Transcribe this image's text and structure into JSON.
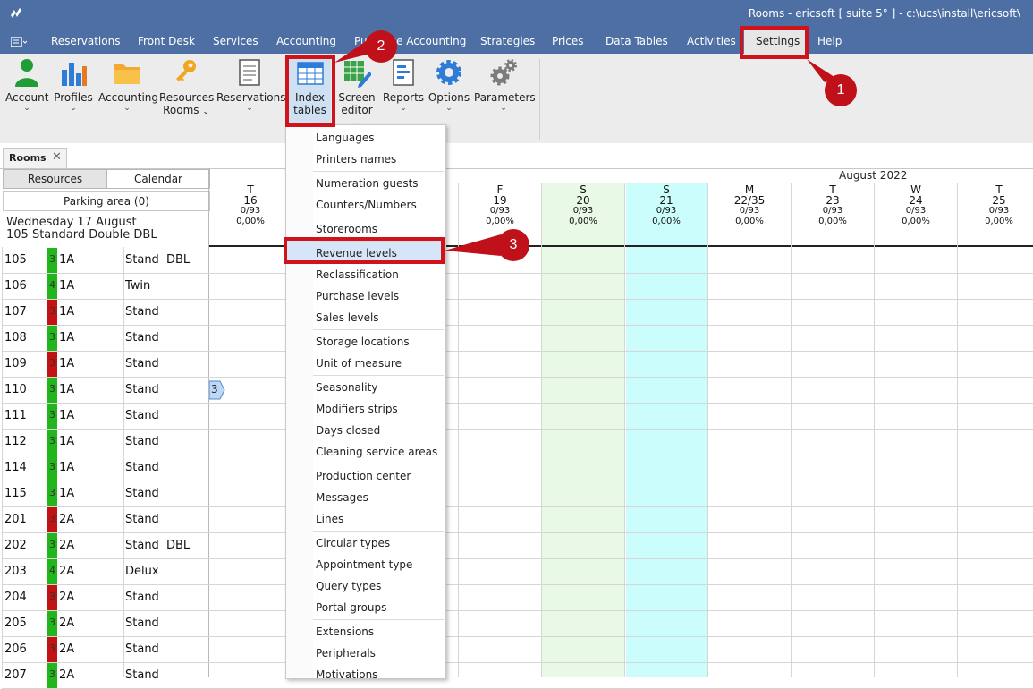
{
  "window": {
    "title": "Rooms - ericsoft [ suite 5° ] - c:\\ucs\\install\\ericsoft\\"
  },
  "menu": [
    "Reservations",
    "Front Desk",
    "Services",
    "Accounting",
    "Purchase Accounting",
    "Strategies",
    "Prices",
    "Data Tables",
    "Activities",
    "Settings",
    "Help"
  ],
  "ribbon": {
    "account": "Account",
    "profiles": "Profiles",
    "accounting": "Accounting",
    "resources_rooms": [
      "Resources",
      "Rooms"
    ],
    "reservations": "Reservations",
    "index_tables": [
      "Index",
      "tables"
    ],
    "screen_editor": [
      "Screen",
      "editor"
    ],
    "reports": "Reports",
    "options": "Options",
    "parameters": "Parameters"
  },
  "badges": [
    "1",
    "2",
    "3"
  ],
  "tabs": {
    "rooms": "Rooms",
    "close": "✕"
  },
  "left_panel": {
    "resources_tab": "Resources",
    "calendar_tab": "Calendar",
    "parking": "Parking area (0)",
    "date_line": "Wednesday 17 August",
    "room_line": "105 Standard Double DBL"
  },
  "calendar": {
    "month": "August 2022",
    "days": [
      {
        "dow": "T",
        "day": "16",
        "occ": "0/93",
        "pct": "0,00%"
      },
      {
        "dow": "F",
        "day": "19",
        "occ": "0/93",
        "pct": "0,00%"
      },
      {
        "dow": "S",
        "day": "20",
        "occ": "0/93",
        "pct": "0,00%"
      },
      {
        "dow": "S",
        "day": "21",
        "occ": "0/93",
        "pct": "0,00%"
      },
      {
        "dow": "M",
        "day": "22/35",
        "occ": "0/93",
        "pct": "0,00%"
      },
      {
        "dow": "T",
        "day": "23",
        "occ": "0/93",
        "pct": "0,00%"
      },
      {
        "dow": "W",
        "day": "24",
        "occ": "0/93",
        "pct": "0,00%"
      },
      {
        "dow": "T",
        "day": "25",
        "occ": "0/93",
        "pct": "0,00%"
      }
    ],
    "booking_marker": "3"
  },
  "rooms": [
    {
      "num": "105",
      "beds": "3",
      "floor": "1A",
      "type": "Stand",
      "bed": "DBL",
      "status": "green"
    },
    {
      "num": "106",
      "beds": "4",
      "floor": "1A",
      "type": "Twin",
      "bed": "",
      "status": "green"
    },
    {
      "num": "107",
      "beds": "3",
      "floor": "1A",
      "type": "Stand",
      "bed": "",
      "status": "red"
    },
    {
      "num": "108",
      "beds": "3",
      "floor": "1A",
      "type": "Stand",
      "bed": "",
      "status": "green"
    },
    {
      "num": "109",
      "beds": "3",
      "floor": "1A",
      "type": "Stand",
      "bed": "",
      "status": "red"
    },
    {
      "num": "110",
      "beds": "3",
      "floor": "1A",
      "type": "Stand",
      "bed": "",
      "status": "green"
    },
    {
      "num": "111",
      "beds": "3",
      "floor": "1A",
      "type": "Stand",
      "bed": "",
      "status": "green"
    },
    {
      "num": "112",
      "beds": "3",
      "floor": "1A",
      "type": "Stand",
      "bed": "",
      "status": "green"
    },
    {
      "num": "114",
      "beds": "3",
      "floor": "1A",
      "type": "Stand",
      "bed": "",
      "status": "green"
    },
    {
      "num": "115",
      "beds": "3",
      "floor": "1A",
      "type": "Stand",
      "bed": "",
      "status": "green"
    },
    {
      "num": "201",
      "beds": "3",
      "floor": "2A",
      "type": "Stand",
      "bed": "",
      "status": "red"
    },
    {
      "num": "202",
      "beds": "3",
      "floor": "2A",
      "type": "Stand",
      "bed": "DBL",
      "status": "green"
    },
    {
      "num": "203",
      "beds": "4",
      "floor": "2A",
      "type": "Delux",
      "bed": "",
      "status": "green"
    },
    {
      "num": "204",
      "beds": "3",
      "floor": "2A",
      "type": "Stand",
      "bed": "",
      "status": "red"
    },
    {
      "num": "205",
      "beds": "3",
      "floor": "2A",
      "type": "Stand",
      "bed": "",
      "status": "green"
    },
    {
      "num": "206",
      "beds": "3",
      "floor": "2A",
      "type": "Stand",
      "bed": "",
      "status": "red"
    },
    {
      "num": "207",
      "beds": "3",
      "floor": "2A",
      "type": "Stand",
      "bed": "",
      "status": "green"
    }
  ],
  "dropdown": [
    "Languages",
    "Printers names",
    "Numeration guests",
    "Counters/Numbers",
    "Storerooms",
    "Revenue levels",
    "Reclassification",
    "Purchase levels",
    "Sales levels",
    "Storage locations",
    "Unit of measure",
    "Seasonality",
    "Modifiers strips",
    "Days closed",
    "Cleaning service areas",
    "Production center",
    "Messages",
    "Lines",
    "Circular types",
    "Appointment type",
    "Query types",
    "Portal groups",
    "Extensions",
    "Peripherals",
    "Motivations"
  ],
  "colors": {
    "header": "#4d6fa3",
    "highlight": "#d0121b",
    "green_col": "#e8f9e6",
    "cyan_col": "#ccfdfd",
    "status_green": "#21b61b",
    "status_red": "#c11313"
  }
}
